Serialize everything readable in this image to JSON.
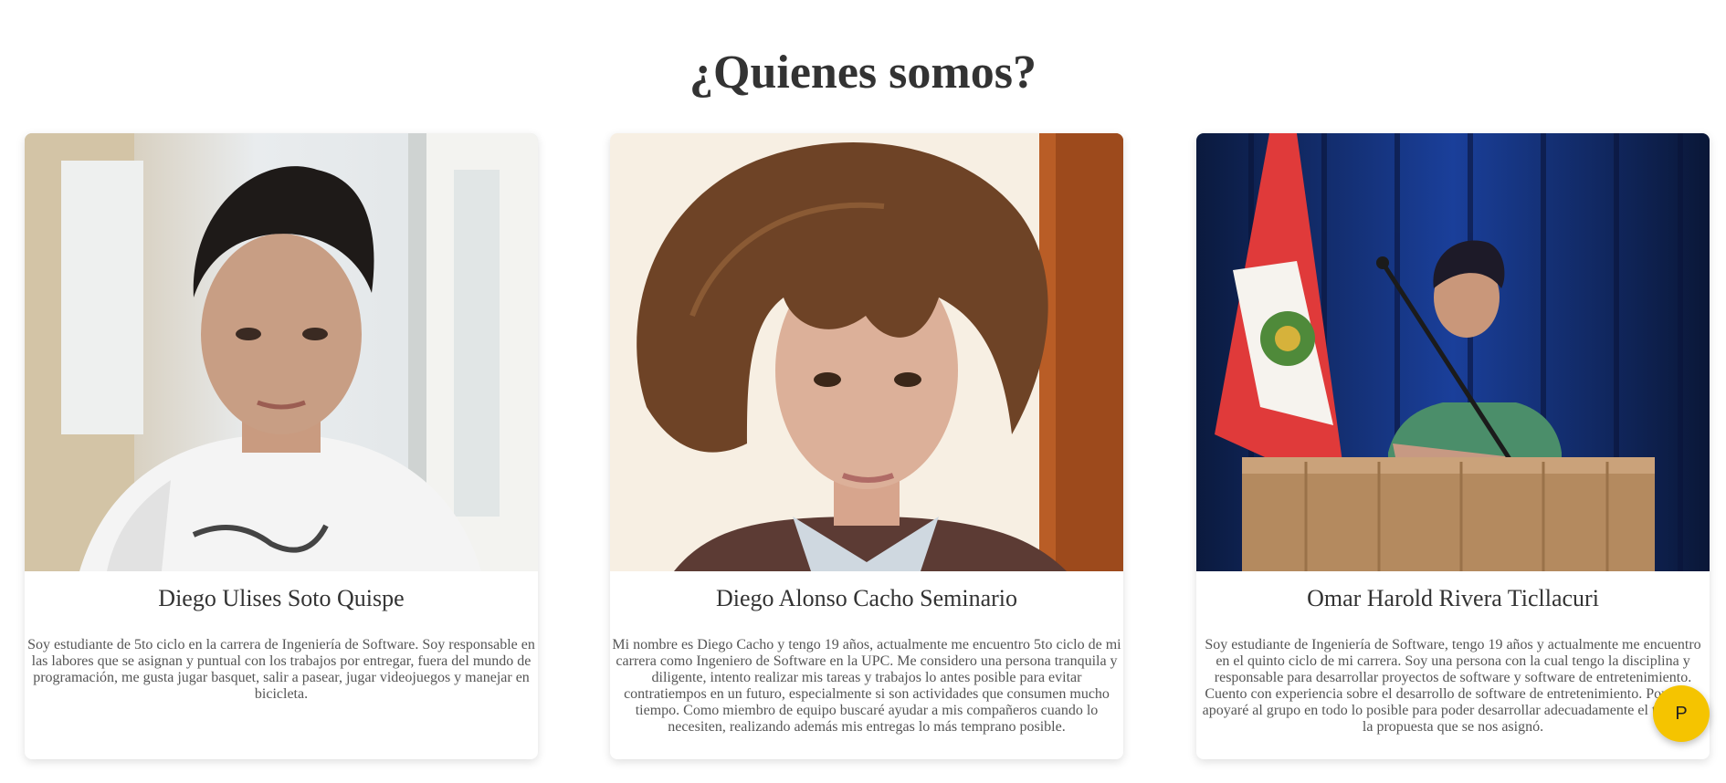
{
  "section": {
    "title": "¿Quienes somos?"
  },
  "members": [
    {
      "name": "Diego Ulises Soto Quispe",
      "description": "Soy estudiante de 5to ciclo en la carrera de Ingeniería de Software. Soy responsable en las labores que se asignan y puntual con los trabajos por entregar, fuera del mundo de programación, me gusta jugar basquet, salir a pasear, jugar videojuegos y manejar en bicicleta."
    },
    {
      "name": "Diego Alonso Cacho Seminario",
      "description": "Mi nombre es Diego Cacho y tengo 19 años, actualmente me encuentro 5to ciclo de mi carrera como Ingeniero de Software en la UPC. Me considero una persona tranquila y diligente, intento realizar mis tareas y trabajos lo antes posible para evitar contratiempos en un futuro, especialmente si son actividades que consumen mucho tiempo. Como miembro de equipo buscaré ayudar a mis compañeros cuando lo necesiten, realizando además mis entregas lo más temprano posible."
    },
    {
      "name": "Omar Harold Rivera Ticllacuri",
      "description": "Soy estudiante de Ingeniería de Software, tengo 19 años y actualmente me encuentro en el quinto ciclo de mi carrera. Soy una persona con la cual tengo la disciplina y responsable para desarrollar proyectos de software y software de entretenimiento. Cuento con experiencia sobre el desarrollo de software de entretenimiento. Por ende, apoyaré al grupo en todo lo posible para poder desarrollar adecuadamente el trabajo y la propuesta que se nos asignó."
    }
  ],
  "fab": {
    "label": "P"
  },
  "colors": {
    "fab_background": "#f5c400",
    "title_text": "#333333",
    "body_text": "#555555"
  }
}
